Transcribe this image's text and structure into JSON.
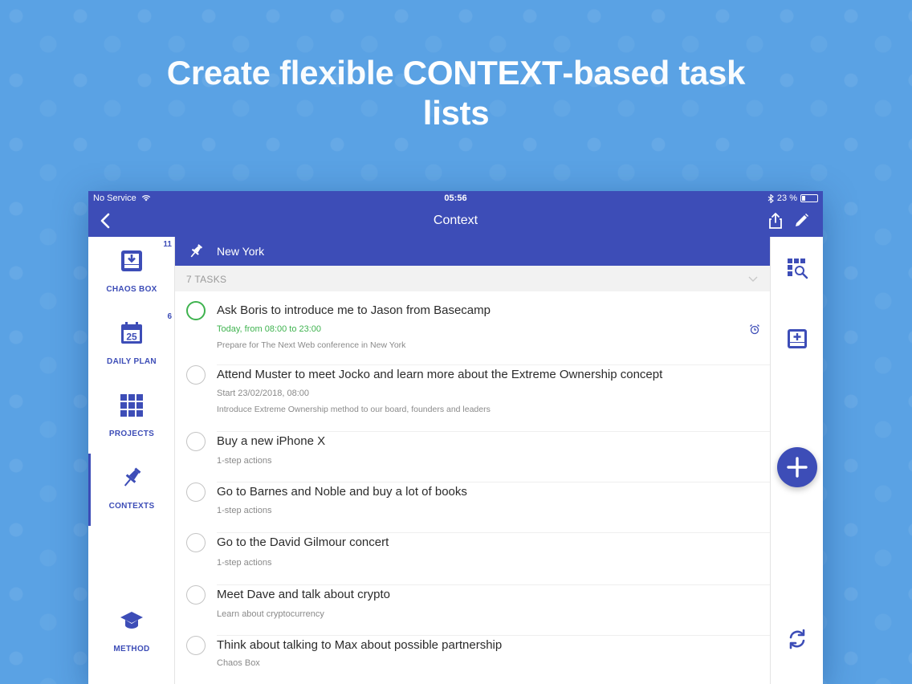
{
  "headline": {
    "part1": "Create flexible ",
    "part2": "CONTEXT",
    "part3": "-based task",
    "line2": "lists"
  },
  "status_bar": {
    "carrier": "No Service",
    "time": "05:56",
    "battery": "23 %"
  },
  "nav": {
    "title": "Context"
  },
  "sidebar": {
    "items": [
      {
        "label": "CHAOS BOX",
        "badge": "11",
        "icon": "inbox-icon"
      },
      {
        "label": "DAILY PLAN",
        "badge": "6",
        "icon": "calendar-icon",
        "calendar_day": "25"
      },
      {
        "label": "PROJECTS",
        "badge": "",
        "icon": "grid-icon"
      },
      {
        "label": "CONTEXTS",
        "badge": "",
        "icon": "pin-icon"
      },
      {
        "label": "METHOD",
        "badge": "",
        "icon": "graduation-cap-icon"
      }
    ]
  },
  "context": {
    "name": "New York",
    "task_count": "7 TASKS"
  },
  "tasks": [
    {
      "title": "Ask Boris to introduce me to Jason from Basecamp",
      "line1": "Today, from 08:00 to 23:00",
      "line2": "Prepare for The Next Web conference in New York"
    },
    {
      "title": "Attend Muster to meet Jocko and learn more about the Extreme Ownership concept",
      "line1": "Start 23/02/2018, 08:00",
      "line2": "Introduce Extreme Ownership method to our board, founders and leaders"
    },
    {
      "title": "Buy a new iPhone X",
      "line1": "1-step actions"
    },
    {
      "title": "Go to Barnes and Noble and buy a lot of books",
      "line1": "1-step actions"
    },
    {
      "title": "Go to the David Gilmour concert",
      "line1": "1-step actions"
    },
    {
      "title": "Meet Dave and talk about crypto",
      "line1": "Learn about cryptocurrency"
    },
    {
      "title": "Think about talking to Max about possible partnership",
      "line1": "Chaos Box"
    }
  ],
  "colors": {
    "primary": "#3d4db7",
    "background": "#5aa2e4",
    "green": "#3fb34f"
  }
}
